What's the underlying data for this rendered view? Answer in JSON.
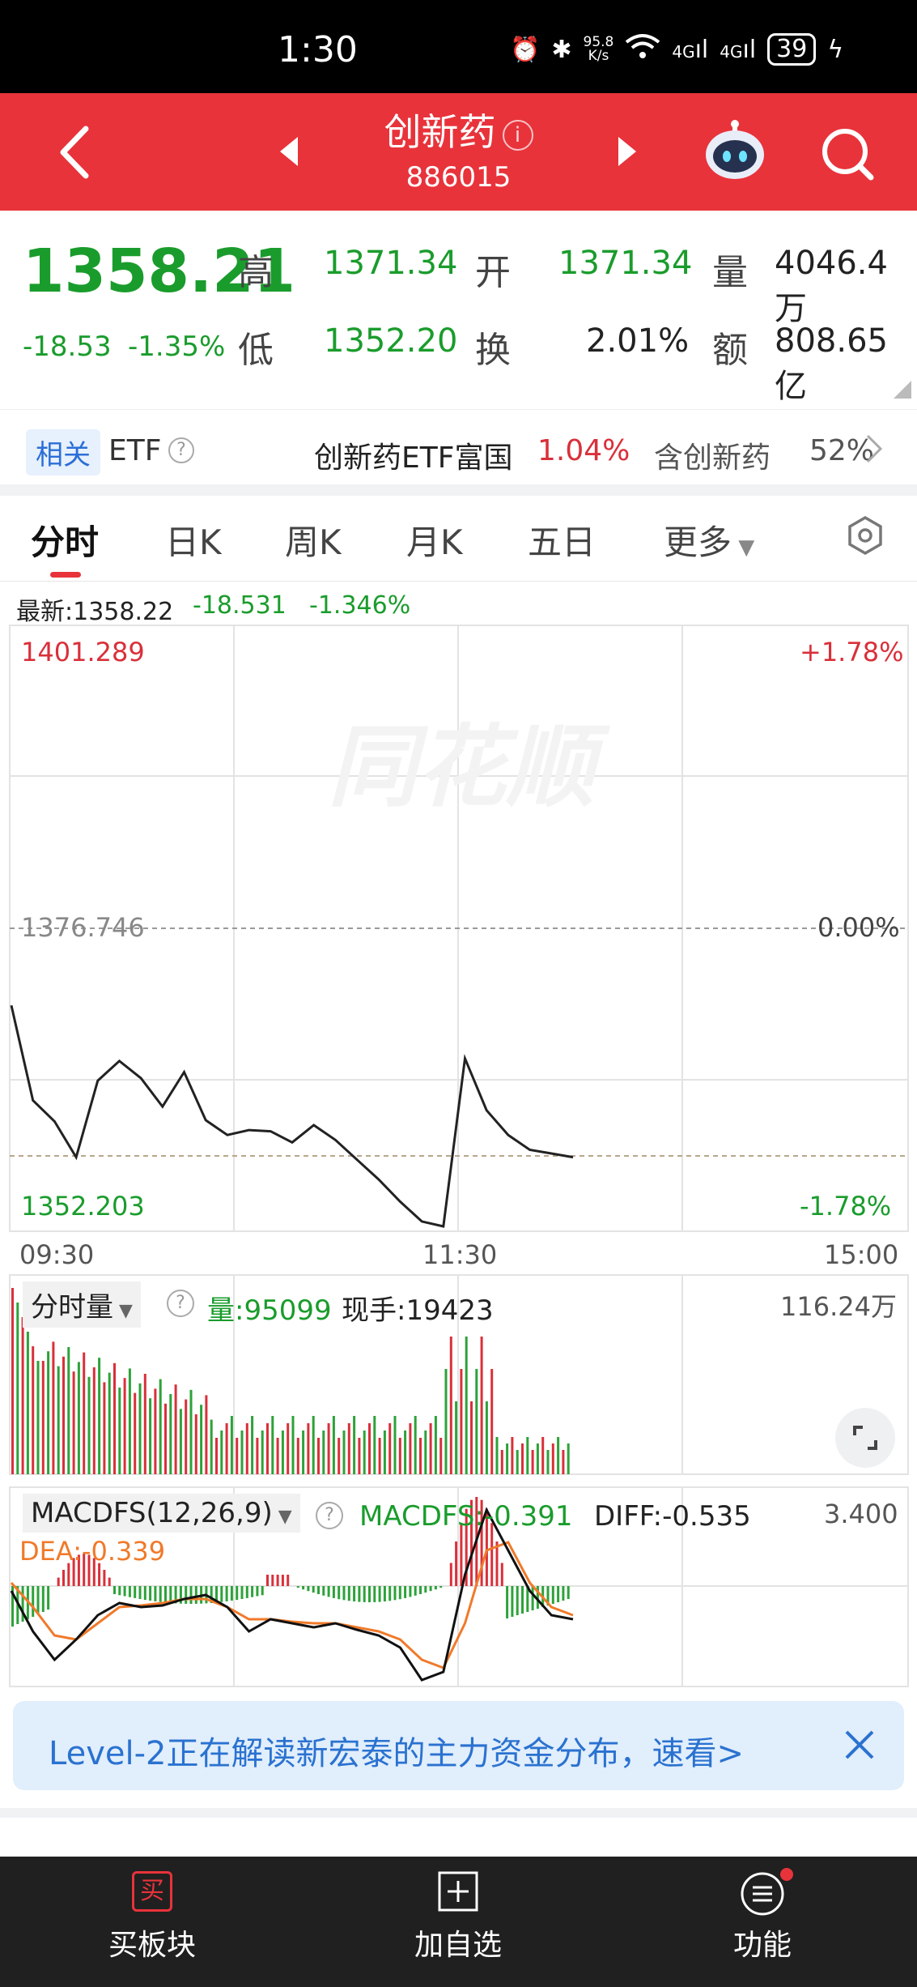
{
  "status": {
    "time": "1:30",
    "net_speed_top": "95.8",
    "net_speed_bottom": "K/s",
    "signal1": "4G",
    "signal2": "4G",
    "battery": "39"
  },
  "header": {
    "title": "创新药",
    "code": "886015"
  },
  "quote": {
    "price": "1358.21",
    "change": "-18.53",
    "change_pct": "-1.35%",
    "high_label": "高",
    "high": "1371.34",
    "low_label": "低",
    "low": "1352.20",
    "open_label": "开",
    "open": "1371.34",
    "turnover_label": "换",
    "turnover": "2.01%",
    "volume_label": "量",
    "volume": "4046.4万",
    "amount_label": "额",
    "amount": "808.65亿"
  },
  "related": {
    "tag": "相关",
    "etf_label": "ETF",
    "etf_name": "创新药ETF富国",
    "etf_change": "1.04%",
    "contains_label": "含创新药",
    "contains_pct": "52%"
  },
  "tabs": [
    "分时",
    "日K",
    "周K",
    "月K",
    "五日",
    "更多"
  ],
  "intraday": {
    "latest_label": "最新:1358.22",
    "latest_change": "-18.531",
    "latest_pct": "-1.346%",
    "top_price": "1401.289",
    "top_pct": "+1.78%",
    "mid_price": "1376.746",
    "mid_pct": "0.00%",
    "bottom_price": "1352.203",
    "bottom_pct": "-1.78%",
    "time_start": "09:30",
    "time_mid": "11:30",
    "time_end": "15:00",
    "watermark": "同花顺"
  },
  "volume_panel": {
    "selector": "分时量",
    "vol_label": "量:95099",
    "hand_label": "现手:19423",
    "max": "116.24万"
  },
  "macd_panel": {
    "selector": "MACDFS(12,26,9)",
    "macdfs": "MACDFS:-0.391",
    "diff": "DIFF:-0.535",
    "dea": "DEA:-0.339",
    "max": "3.400"
  },
  "banner": {
    "text": "Level-2正在解读新宏泰的主力资金分布，速看>"
  },
  "bottom_bar": {
    "buy_icon_text": "买",
    "buy_label": "买板块",
    "add_label": "加自选",
    "func_label": "功能"
  },
  "chart_data": {
    "type": "line",
    "title": "",
    "x": [
      "09:30",
      "11:30",
      "15:00"
    ],
    "ylim": [
      1352.203,
      1401.289
    ],
    "baseline": 1376.746,
    "series": [
      {
        "values": [
          1370.5,
          1362.8,
          1361.1,
          1358.2,
          1364.4,
          1366.0,
          1364.6,
          1362.3,
          1365.1,
          1361.2,
          1360.0,
          1360.4,
          1360.3,
          1359.4,
          1360.8,
          1359.6,
          1358.0,
          1356.4,
          1354.6,
          1353.0,
          1352.6,
          1366.2,
          1362.0,
          1360.0,
          1358.8,
          1358.5,
          1358.2
        ]
      }
    ]
  }
}
